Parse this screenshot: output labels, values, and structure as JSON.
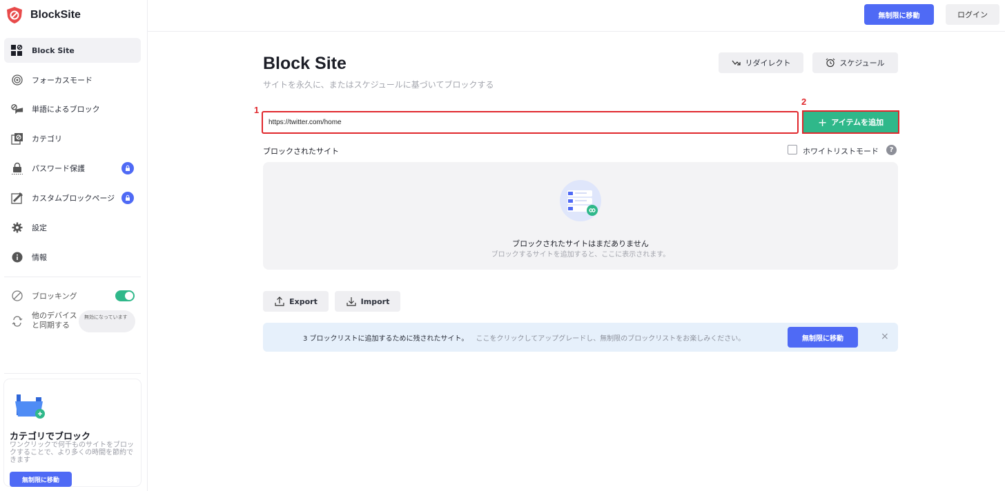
{
  "app": {
    "name": "BlockSite"
  },
  "header": {
    "upgrade_label": "無制限に移動",
    "login_label": "ログイン"
  },
  "sidebar": {
    "items": [
      {
        "label": "Block Site",
        "icon": "block-site-icon"
      },
      {
        "label": "フォーカスモード",
        "icon": "focus-target-icon"
      },
      {
        "label": "単語によるブロック",
        "icon": "word-block-icon"
      },
      {
        "label": "カテゴリ",
        "icon": "category-icon"
      },
      {
        "label": "パスワード保護",
        "icon": "password-lock-icon"
      },
      {
        "label": "カスタムブロックページ",
        "icon": "custom-page-icon"
      },
      {
        "label": "設定",
        "icon": "gear-icon"
      },
      {
        "label": "情報",
        "icon": "info-icon"
      }
    ],
    "blocking_label": "ブロッキング",
    "blocking_enabled": true,
    "sync_label": "他のデバイス と同期する",
    "sync_status": "無効になっています"
  },
  "promo": {
    "title": "カテゴリでブロック",
    "description": "ワンクリックで何千ものサイトをブロックすることで、より多くの時間を節約できます",
    "button_label": "無制限に移動"
  },
  "main": {
    "title": "Block Site",
    "subtitle": "サイトを永久に、またはスケジュールに基づいてブロックする",
    "redirect_label": "リダイレクト",
    "schedule_label": "スケジュール",
    "url_value": "https://twitter.com/home",
    "add_label": "アイテムを追加",
    "step1": "1",
    "step2": "2",
    "blocked_sites_label": "ブロックされたサイト",
    "whitelist_label": "ホワイトリストモード",
    "help_label": "?",
    "empty_title": "ブロックされたサイトはまだありません",
    "empty_subtitle": "ブロックするサイトを追加すると、ここに表示されます。",
    "export_label": "Export",
    "import_label": "Import"
  },
  "banner": {
    "text": "3 ブロックリストに追加するために残されたサイト。",
    "link": "ここをクリックしてアップグレードし、無制限のブロックリストをお楽しみください。",
    "button_label": "無制限に移動",
    "close": "×"
  },
  "colors": {
    "accent": "#4f6af5",
    "green": "#2fb88a",
    "highlight": "#e0262b"
  }
}
